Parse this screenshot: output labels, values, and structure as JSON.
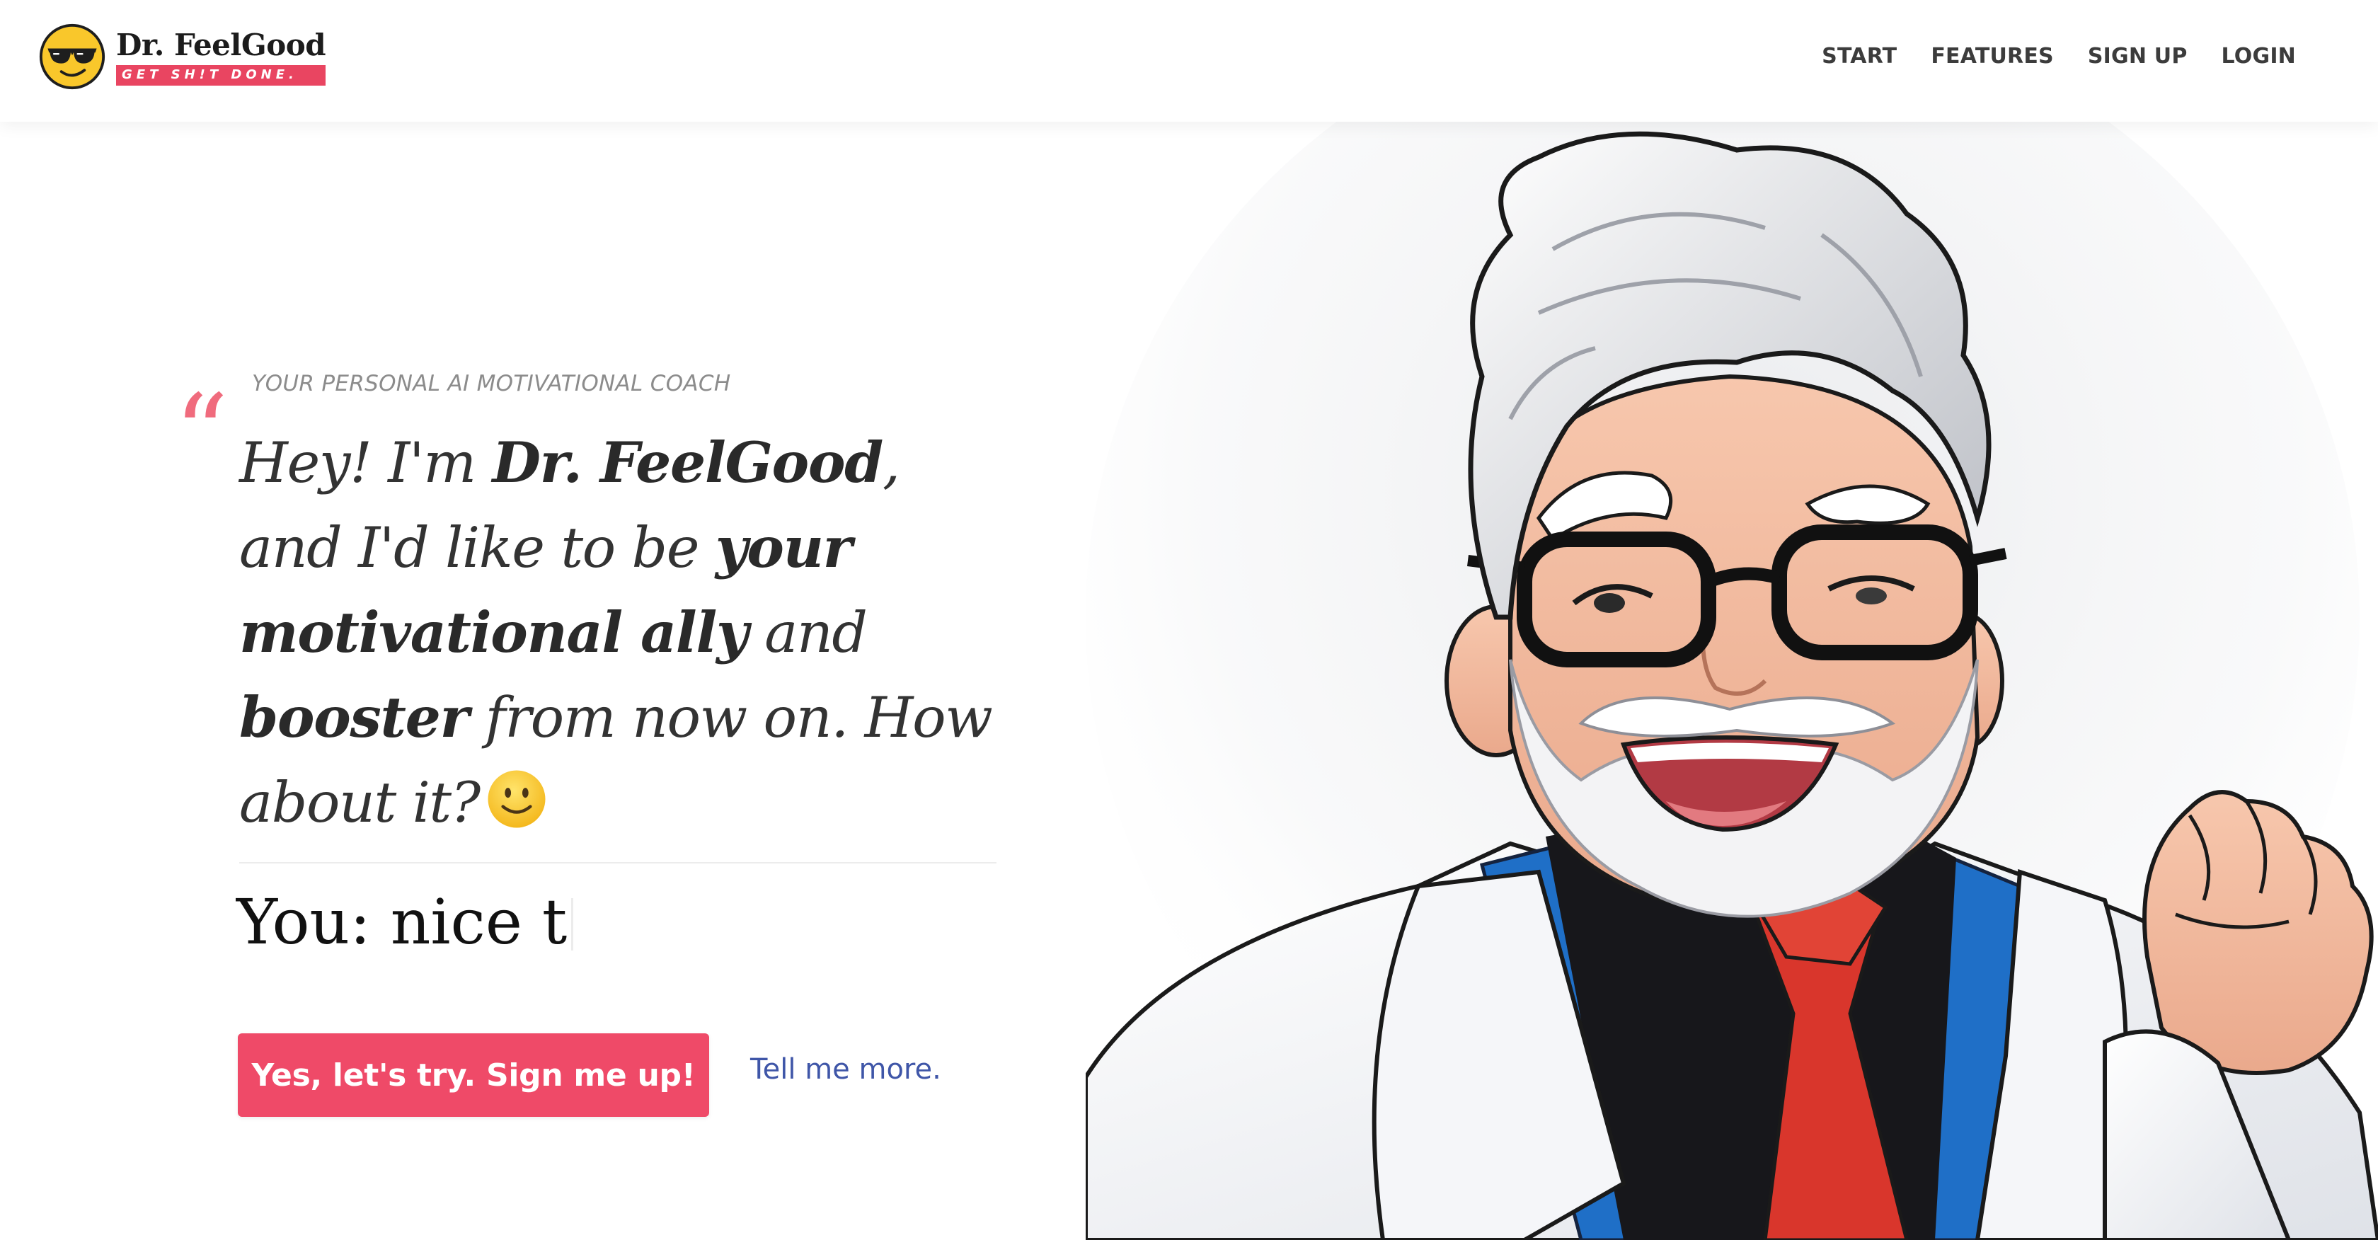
{
  "brand": {
    "name": "Dr. FeelGood",
    "tagline": "GET SH!T DONE.",
    "logo_icon": "sunglasses-smiley-icon",
    "accent_color": "#e94561"
  },
  "nav": {
    "items": [
      {
        "label": "START"
      },
      {
        "label": "FEATURES"
      },
      {
        "label": "SIGN UP"
      },
      {
        "label": "LOGIN"
      }
    ]
  },
  "hero": {
    "eyebrow": "YOUR PERSONAL AI MOTIVATIONAL COACH",
    "quote_mark": "“",
    "quote": {
      "part1": "Hey! I'm ",
      "name": "Dr. FeelGood",
      "part2": ", and I'd like to be ",
      "strong1": "your motivational ally",
      "part3": " and ",
      "strong2": "booster",
      "part4": " from now on. How about it?"
    },
    "emoji_icon": "slightly-smiling-face-icon",
    "user_reply": "You: nice t",
    "cta_label": "Yes, let's try. Sign me up!",
    "secondary_link": "Tell me more.",
    "cta_color": "#ef4a68",
    "link_color": "#3f56a8"
  },
  "illustration": {
    "icon": "doctor-character-illustration"
  }
}
